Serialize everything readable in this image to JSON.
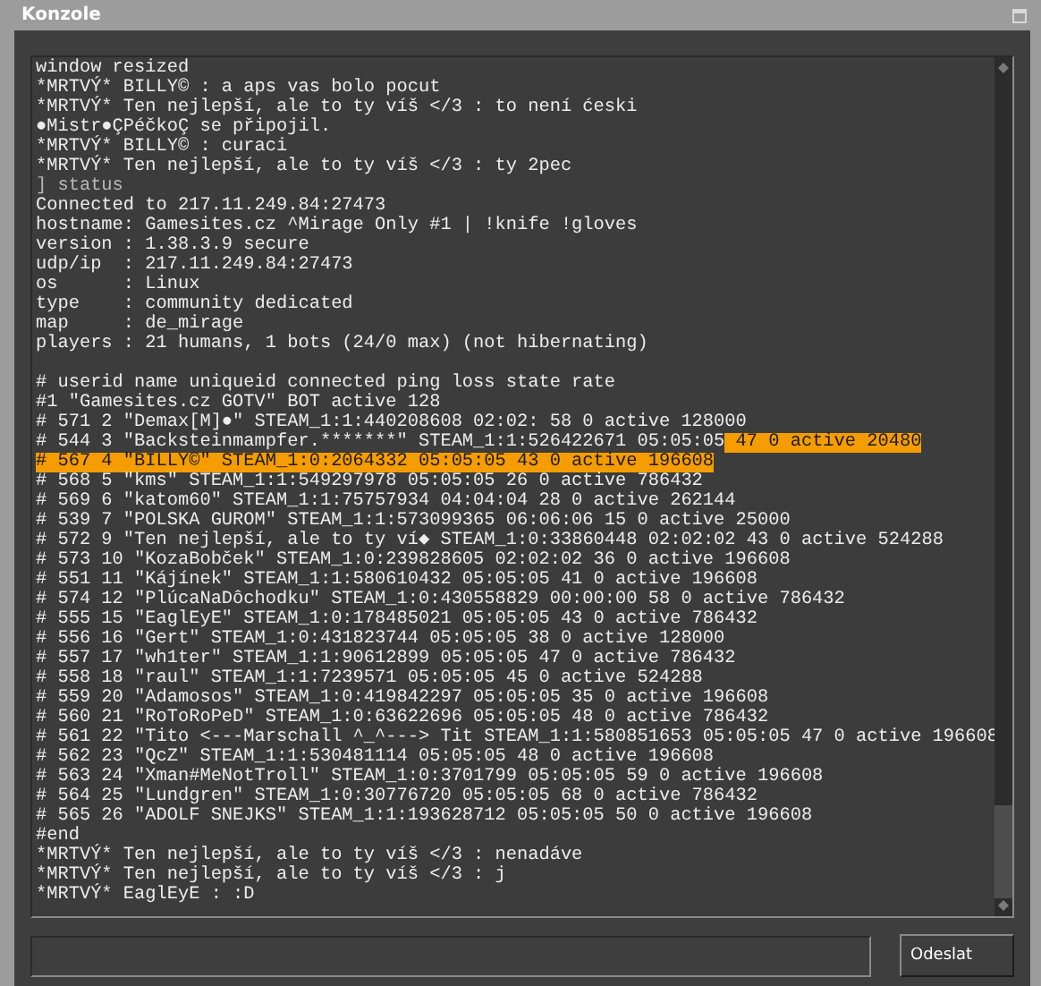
{
  "window": {
    "title": "Konzole"
  },
  "console": {
    "lines": [
      {
        "kind": "text",
        "spans": [
          {
            "text": "window resized",
            "selected": false
          }
        ]
      },
      {
        "kind": "text",
        "spans": [
          {
            "text": "*MRTVÝ* BILLY© : a aps vas bolo pocut",
            "selected": false
          }
        ]
      },
      {
        "kind": "text",
        "spans": [
          {
            "text": "*MRTVÝ* Ten nejlepší, ale to ty víš </3 : to není ćeski",
            "selected": false
          }
        ]
      },
      {
        "kind": "text",
        "spans": [
          {
            "text": "●Mistr●ÇPéčkoÇ se připojil.",
            "selected": false
          }
        ]
      },
      {
        "kind": "text",
        "spans": [
          {
            "text": "*MRTVÝ* BILLY© : curaci",
            "selected": false
          }
        ]
      },
      {
        "kind": "text",
        "spans": [
          {
            "text": "*MRTVÝ* Ten nejlepší, ale to ty víš </3 : ty 2pec",
            "selected": false
          }
        ]
      },
      {
        "kind": "command",
        "spans": [
          {
            "text": "] status",
            "selected": false
          }
        ]
      },
      {
        "kind": "text",
        "spans": [
          {
            "text": "Connected to 217.11.249.84:27473",
            "selected": false
          }
        ]
      },
      {
        "kind": "text",
        "spans": [
          {
            "text": "hostname: Gamesites.cz ^Mirage Only #1 | !knife !gloves",
            "selected": false
          }
        ]
      },
      {
        "kind": "text",
        "spans": [
          {
            "text": "version : 1.38.3.9 secure",
            "selected": false
          }
        ]
      },
      {
        "kind": "text",
        "spans": [
          {
            "text": "udp/ip  : 217.11.249.84:27473",
            "selected": false
          }
        ]
      },
      {
        "kind": "text",
        "spans": [
          {
            "text": "os      : Linux",
            "selected": false
          }
        ]
      },
      {
        "kind": "text",
        "spans": [
          {
            "text": "type    : community dedicated",
            "selected": false
          }
        ]
      },
      {
        "kind": "text",
        "spans": [
          {
            "text": "map     : de_mirage",
            "selected": false
          }
        ]
      },
      {
        "kind": "text",
        "spans": [
          {
            "text": "players : 21 humans, 1 bots (24/0 max) (not hibernating)",
            "selected": false
          }
        ]
      },
      {
        "kind": "blank"
      },
      {
        "kind": "text",
        "spans": [
          {
            "text": "# userid name uniqueid connected ping loss state rate",
            "selected": false
          }
        ]
      },
      {
        "kind": "text",
        "spans": [
          {
            "text": "#1 \"Gamesites.cz GOTV\" BOT active 128",
            "selected": false
          }
        ]
      },
      {
        "kind": "text",
        "spans": [
          {
            "text": "# 571 2 \"Demax[M]●\" STEAM_1:1:440208608 02:02: 58 0 active 128000",
            "selected": false
          }
        ]
      },
      {
        "kind": "text",
        "spans": [
          {
            "text": "# 544 3 \"Backsteinmampfer.*******\" STEAM_1:1:526422671 05:05:05",
            "selected": false
          },
          {
            "text": " 47 0 active 20480",
            "selected": true
          }
        ]
      },
      {
        "kind": "text",
        "spans": [
          {
            "text": "# 567 4 \"BILLY©\" STEAM_1:0:2064332 05:05:05 43 0 active 196608",
            "selected": true
          }
        ]
      },
      {
        "kind": "text",
        "spans": [
          {
            "text": "# 568 5 \"kms\" STEAM_1:1:549297978 05:05:05 26 0 active 786432",
            "selected": false
          }
        ]
      },
      {
        "kind": "text",
        "spans": [
          {
            "text": "# 569 6 \"katom60\" STEAM_1:1:75757934 04:04:04 28 0 active 262144",
            "selected": false
          }
        ]
      },
      {
        "kind": "text",
        "spans": [
          {
            "text": "# 539 7 \"POLSKA GUROM\" STEAM_1:1:573099365 06:06:06 15 0 active 25000",
            "selected": false
          }
        ]
      },
      {
        "kind": "text",
        "spans": [
          {
            "text": "# 572 9 \"Ten nejlepší, ale to ty ví◆ STEAM_1:0:33860448 02:02:02 43 0 active 524288",
            "selected": false
          }
        ]
      },
      {
        "kind": "text",
        "spans": [
          {
            "text": "# 573 10 \"KozaBobček\" STEAM_1:0:239828605 02:02:02 36 0 active 196608",
            "selected": false
          }
        ]
      },
      {
        "kind": "text",
        "spans": [
          {
            "text": "# 551 11 \"Kájínek\" STEAM_1:1:580610432 05:05:05 41 0 active 196608",
            "selected": false
          }
        ]
      },
      {
        "kind": "text",
        "spans": [
          {
            "text": "# 574 12 \"PlúcaNaDôchodku\" STEAM_1:0:430558829 00:00:00 58 0 active 786432",
            "selected": false
          }
        ]
      },
      {
        "kind": "text",
        "spans": [
          {
            "text": "# 555 15 \"EaglEyE\" STEAM_1:0:178485021 05:05:05 43 0 active 786432",
            "selected": false
          }
        ]
      },
      {
        "kind": "text",
        "spans": [
          {
            "text": "# 556 16 \"Gert\" STEAM_1:0:431823744 05:05:05 38 0 active 128000",
            "selected": false
          }
        ]
      },
      {
        "kind": "text",
        "spans": [
          {
            "text": "# 557 17 \"wh1ter\" STEAM_1:1:90612899 05:05:05 47 0 active 786432",
            "selected": false
          }
        ]
      },
      {
        "kind": "text",
        "spans": [
          {
            "text": "# 558 18 \"raul\" STEAM_1:1:7239571 05:05:05 45 0 active 524288",
            "selected": false
          }
        ]
      },
      {
        "kind": "text",
        "spans": [
          {
            "text": "# 559 20 \"Adamosos\" STEAM_1:0:419842297 05:05:05 35 0 active 196608",
            "selected": false
          }
        ]
      },
      {
        "kind": "text",
        "spans": [
          {
            "text": "# 560 21 \"RoToRoPeD\" STEAM_1:0:63622696 05:05:05 48 0 active 786432",
            "selected": false
          }
        ]
      },
      {
        "kind": "text",
        "spans": [
          {
            "text": "# 561 22 \"Tito <---Marschall ^_^---> Tit STEAM_1:1:580851653 05:05:05 47 0 active 196608",
            "selected": false
          }
        ]
      },
      {
        "kind": "text",
        "spans": [
          {
            "text": "# 562 23 \"QcZ\" STEAM_1:1:530481114 05:05:05 48 0 active 196608",
            "selected": false
          }
        ]
      },
      {
        "kind": "text",
        "spans": [
          {
            "text": "# 563 24 \"Xman#MeNotTroll\" STEAM_1:0:3701799 05:05:05 59 0 active 196608",
            "selected": false
          }
        ]
      },
      {
        "kind": "text",
        "spans": [
          {
            "text": "# 564 25 \"Lundgren\" STEAM_1:0:30776720 05:05:05 68 0 active 786432",
            "selected": false
          }
        ]
      },
      {
        "kind": "text",
        "spans": [
          {
            "text": "# 565 26 \"ADOLF SNEJKS\" STEAM_1:1:193628712 05:05:05 50 0 active 196608",
            "selected": false
          }
        ]
      },
      {
        "kind": "text",
        "spans": [
          {
            "text": "#end",
            "selected": false
          }
        ]
      },
      {
        "kind": "text",
        "spans": [
          {
            "text": "*MRTVÝ* Ten nejlepší, ale to ty víš </3 : nenadáve",
            "selected": false
          }
        ]
      },
      {
        "kind": "text",
        "spans": [
          {
            "text": "*MRTVÝ* Ten nejlepší, ale to ty víš </3 : j",
            "selected": false
          }
        ]
      },
      {
        "kind": "text",
        "spans": [
          {
            "text": "*MRTVÝ* EaglEyE : :D",
            "selected": false
          }
        ]
      }
    ]
  },
  "send_button": {
    "label": "Odeslat"
  }
}
